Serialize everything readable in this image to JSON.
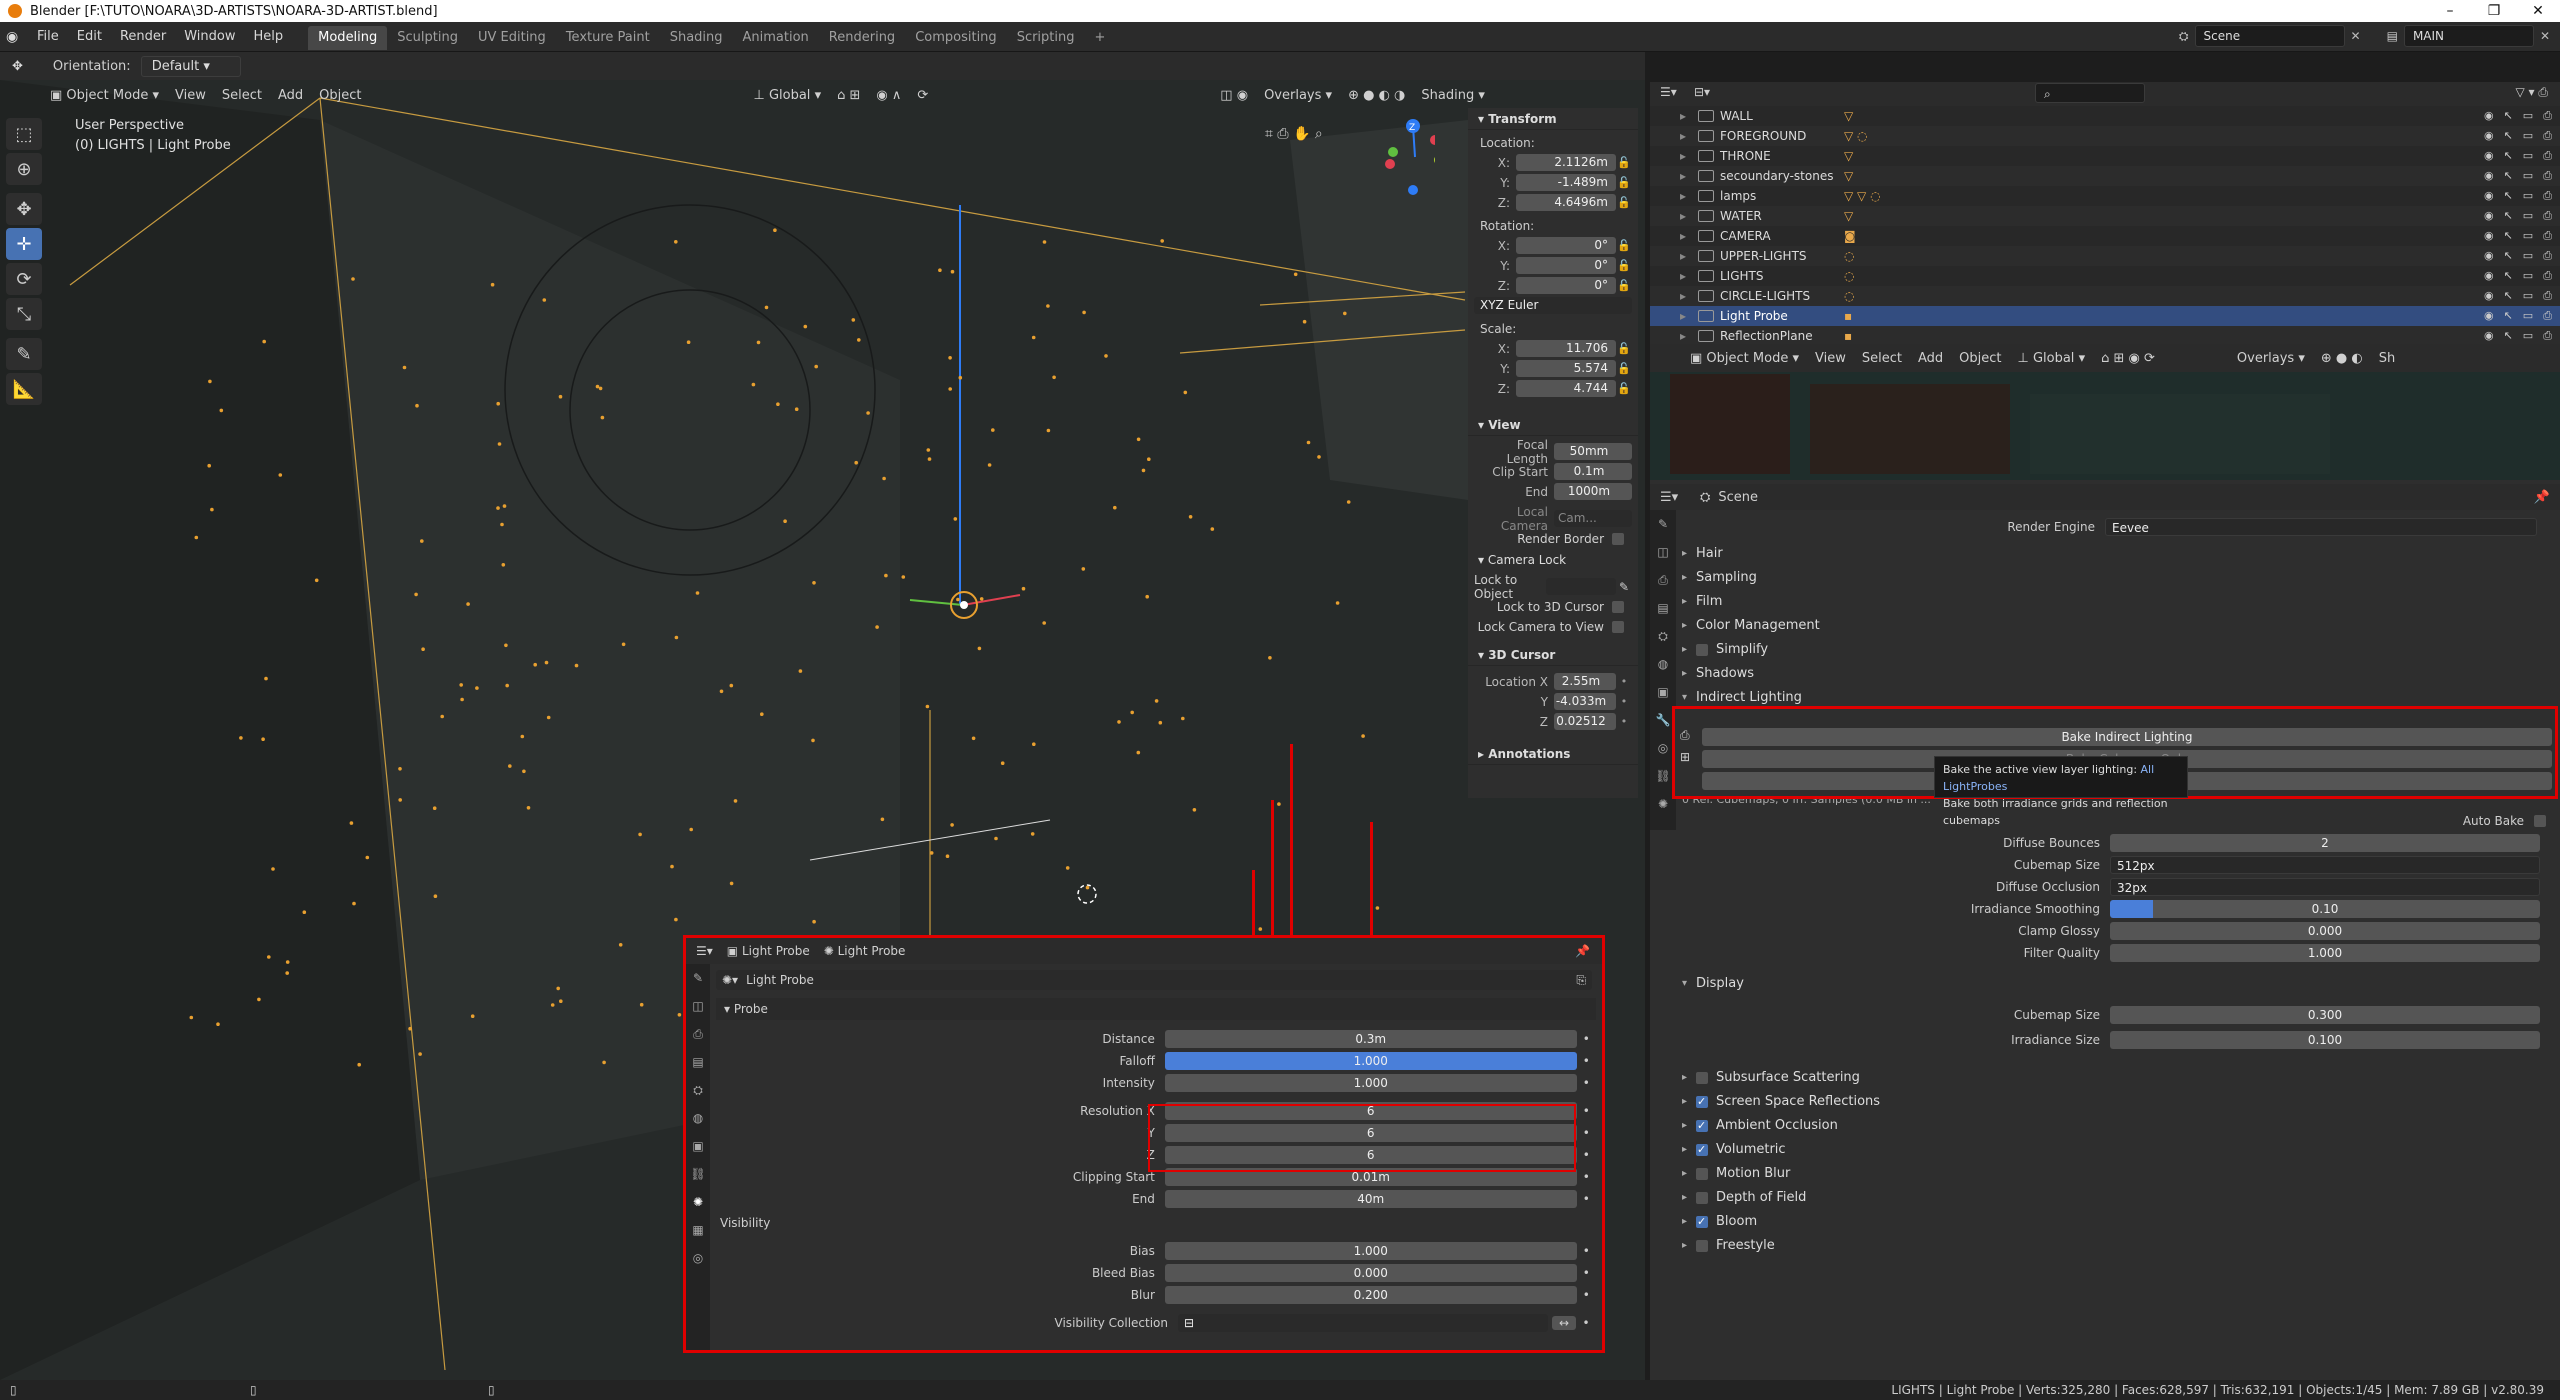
{
  "window": {
    "title": "Blender [F:\\TUTO\\NOARA\\3D-ARTISTS\\NOARA-3D-ARTIST.blend]"
  },
  "menu": [
    "File",
    "Edit",
    "Render",
    "Window",
    "Help"
  ],
  "workspaces": [
    "Modeling",
    "Sculpting",
    "UV Editing",
    "Texture Paint",
    "Shading",
    "Animation",
    "Rendering",
    "Compositing",
    "Scripting"
  ],
  "topbar_right": {
    "scene": "Scene",
    "view_layer": "MAIN"
  },
  "toolbar": {
    "orientation_label": "Orientation:",
    "orientation_value": "Default"
  },
  "viewport_header": {
    "mode": "Object Mode",
    "view": "View",
    "select": "Select",
    "add": "Add",
    "object": "Object",
    "transform": "Global",
    "overlays": "Overlays",
    "shading": "Shading"
  },
  "viewport_info": {
    "line1": "User Perspective",
    "line2": "(0) LIGHTS | Light Probe"
  },
  "npanel": {
    "transform_title": "Transform",
    "location_label": "Location:",
    "location": [
      {
        "axis": "X:",
        "value": "2.1126m"
      },
      {
        "axis": "Y:",
        "value": "-1.489m"
      },
      {
        "axis": "Z:",
        "value": "4.6496m"
      }
    ],
    "rotation_label": "Rotation:",
    "rotation": [
      {
        "axis": "X:",
        "value": "0°"
      },
      {
        "axis": "Y:",
        "value": "0°"
      },
      {
        "axis": "Z:",
        "value": "0°"
      }
    ],
    "rotation_mode": "XYZ Euler",
    "scale_label": "Scale:",
    "scale": [
      {
        "axis": "X:",
        "value": "11.706"
      },
      {
        "axis": "Y:",
        "value": "5.574"
      },
      {
        "axis": "Z:",
        "value": "4.744"
      }
    ],
    "view_title": "View",
    "focal_label": "Focal Length",
    "focal": "50mm",
    "clip_start_label": "Clip Start",
    "clip_start": "0.1m",
    "end_label": "End",
    "end": "1000m",
    "local_camera_label": "Local Camera",
    "local_camera": "Cam...",
    "render_border": "Render Border",
    "camera_lock_title": "Camera Lock",
    "lock_to_object": "Lock to Object",
    "lock_to_cursor": "Lock to 3D Cursor",
    "lock_camera_to_view": "Lock Camera to View",
    "cursor_title": "3D Cursor",
    "cursor_location_label": "Location X",
    "cursor": [
      {
        "axis": "Location X",
        "value": "2.55m"
      },
      {
        "axis": "Y",
        "value": "-4.033m"
      },
      {
        "axis": "Z",
        "value": "0.02512"
      }
    ],
    "annotations_title": "Annotations"
  },
  "outliner": {
    "rows": [
      {
        "name": "WALL",
        "chips": "▽"
      },
      {
        "name": "FOREGROUND",
        "chips": "▽ ◌"
      },
      {
        "name": "THRONE",
        "chips": "▽"
      },
      {
        "name": "secoundary-stones",
        "chips": "▽"
      },
      {
        "name": "lamps",
        "chips": "▽ ▽ ◌"
      },
      {
        "name": "WATER",
        "chips": "▽"
      },
      {
        "name": "CAMERA",
        "chips": "◙"
      },
      {
        "name": "UPPER-LIGHTS",
        "chips": "◌"
      },
      {
        "name": "LIGHTS",
        "chips": "◌"
      },
      {
        "name": "CIRCLE-LIGHTS",
        "chips": "◌"
      },
      {
        "name": "Light Probe",
        "chips": "▪"
      },
      {
        "name": "ReflectionPlane",
        "chips": "▪"
      }
    ]
  },
  "mini_header": {
    "mode": "Object Mode",
    "view": "View",
    "select": "Select",
    "add": "Add",
    "object": "Object",
    "transform": "Global",
    "overlays": "Overlays",
    "shading": "Sh"
  },
  "props": {
    "context": "Scene",
    "render_engine_label": "Render Engine",
    "render_engine": "Eevee",
    "sections_top": [
      "Hair",
      "Sampling",
      "Film",
      "Color Management",
      "Simplify",
      "Shadows",
      "Indirect Lighting"
    ],
    "bake_btn1": "Bake Indirect Lighting",
    "bake_btn2": "Bake Cubemap Only",
    "tooltip_line1": "Bake the active view layer lighting:",
    "tooltip_highlight": "All LightProbes",
    "tooltip_line2": "Bake both irradiance grids and reflection cubemaps",
    "stats_line": "0 Ref. Cubemaps, 0 Irr. Samples (0.0 MB in ...",
    "auto_bake": "Auto Bake",
    "fields": [
      {
        "label": "Diffuse Bounces",
        "value": "2",
        "kind": "num"
      },
      {
        "label": "Cubemap Size",
        "value": "512px",
        "kind": "dd"
      },
      {
        "label": "Diffuse Occlusion",
        "value": "32px",
        "kind": "dd"
      },
      {
        "label": "Irradiance Smoothing",
        "value": "0.10",
        "kind": "num"
      },
      {
        "label": "Clamp Glossy",
        "value": "0.000",
        "kind": "num"
      },
      {
        "label": "Filter Quality",
        "value": "1.000",
        "kind": "num"
      }
    ],
    "irradiance_smoothing_fill": 0.1,
    "display_title": "Display",
    "display_fields": [
      {
        "label": "Cubemap Size",
        "value": "0.300"
      },
      {
        "label": "Irradiance Size",
        "value": "0.100"
      }
    ],
    "sections_bottom": [
      {
        "name": "Subsurface Scattering",
        "checked": false
      },
      {
        "name": "Screen Space Reflections",
        "checked": true
      },
      {
        "name": "Ambient Occlusion",
        "checked": true
      },
      {
        "name": "Volumetric",
        "checked": true
      },
      {
        "name": "Motion Blur",
        "checked": false
      },
      {
        "name": "Depth of Field",
        "checked": false
      },
      {
        "name": "Bloom",
        "checked": true
      },
      {
        "name": "Freestyle",
        "checked": false
      }
    ]
  },
  "lightprobe": {
    "breadcrumb1": "Light Probe",
    "breadcrumb2": "Light Probe",
    "datablock": "Light Probe",
    "probe_title": "Probe",
    "rows1": [
      {
        "label": "Distance",
        "value": "0.3m"
      },
      {
        "label": "Falloff",
        "value": "1.000",
        "active": true
      },
      {
        "label": "Intensity",
        "value": "1.000"
      }
    ],
    "resolution": [
      {
        "label": "Resolution X",
        "value": "6"
      },
      {
        "label": "Y",
        "value": "6"
      },
      {
        "label": "Z",
        "value": "6"
      }
    ],
    "rows2": [
      {
        "label": "Clipping Start",
        "value": "0.01m"
      },
      {
        "label": "End",
        "value": "40m"
      }
    ],
    "visibility_title": "Visibility",
    "rows3": [
      {
        "label": "Bias",
        "value": "1.000"
      },
      {
        "label": "Bleed Bias",
        "value": "0.000"
      },
      {
        "label": "Blur",
        "value": "0.200"
      }
    ],
    "visibility_collection": "Visibility Collection"
  },
  "statusbar": {
    "right": "LIGHTS | Light Probe | Verts:325,280 | Faces:628,597 | Tris:632,191 | Objects:1/45 | Mem: 7.89 GB | v2.80.39"
  },
  "colors": {
    "accent": "#4772b3",
    "highlight_red": "#e00000",
    "light_orange": "#e8a030"
  }
}
